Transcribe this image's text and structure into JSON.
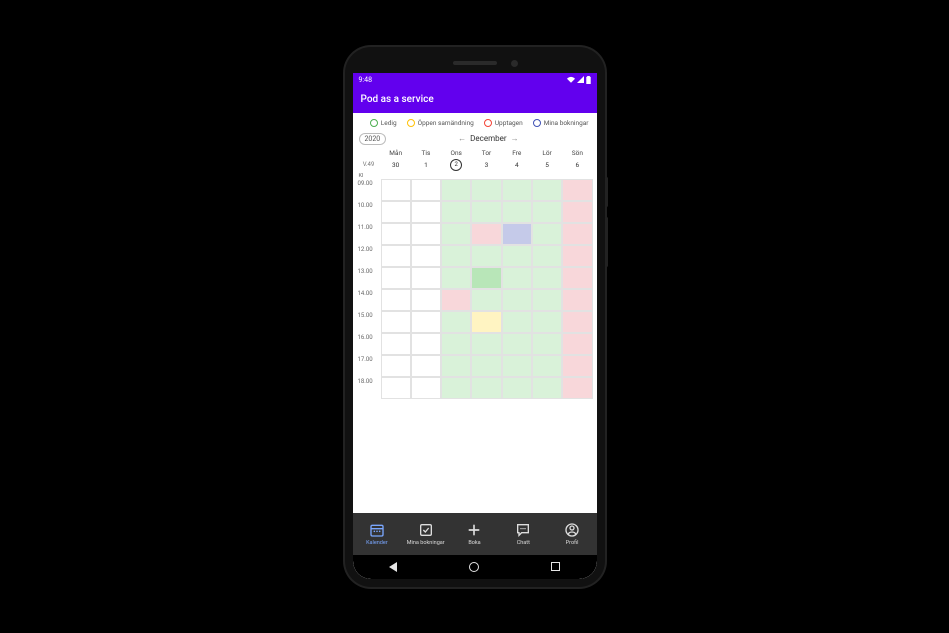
{
  "status": {
    "time": "9:48"
  },
  "app": {
    "title": "Pod as a service"
  },
  "legend": {
    "ledig": "Ledig",
    "upptagen": "Upptagen",
    "oppen": "Öppen samändning",
    "mina": "Mina bokningar"
  },
  "calendar": {
    "year": "2020",
    "month": "December",
    "week": "V.49",
    "days": [
      "Mån",
      "Tis",
      "Ons",
      "Tor",
      "Fre",
      "Lör",
      "Sön"
    ],
    "dates": [
      "30",
      "1",
      "2",
      "3",
      "4",
      "5",
      "6"
    ],
    "today_index": 2,
    "kl": "Kl",
    "times": [
      "09.00",
      "10.00",
      "11.00",
      "12.00",
      "13.00",
      "14.00",
      "15.00",
      "16.00",
      "17.00",
      "18.00"
    ],
    "avail_cols": [
      2,
      3,
      4,
      5
    ],
    "busy_cols": [
      6
    ],
    "events": [
      {
        "hour": 2,
        "day": 3,
        "type": "busy"
      },
      {
        "hour": 2,
        "day": 4,
        "type": "mine"
      },
      {
        "hour": 4,
        "day": 3,
        "type": "green-strong"
      },
      {
        "hour": 5,
        "day": 2,
        "type": "busy"
      },
      {
        "hour": 6,
        "day": 3,
        "type": "open"
      }
    ]
  },
  "nav": {
    "kalender": "Kalender",
    "mina": "Mina bokningar",
    "boka": "Boka",
    "chatt": "Chatt",
    "profil": "Profil"
  }
}
